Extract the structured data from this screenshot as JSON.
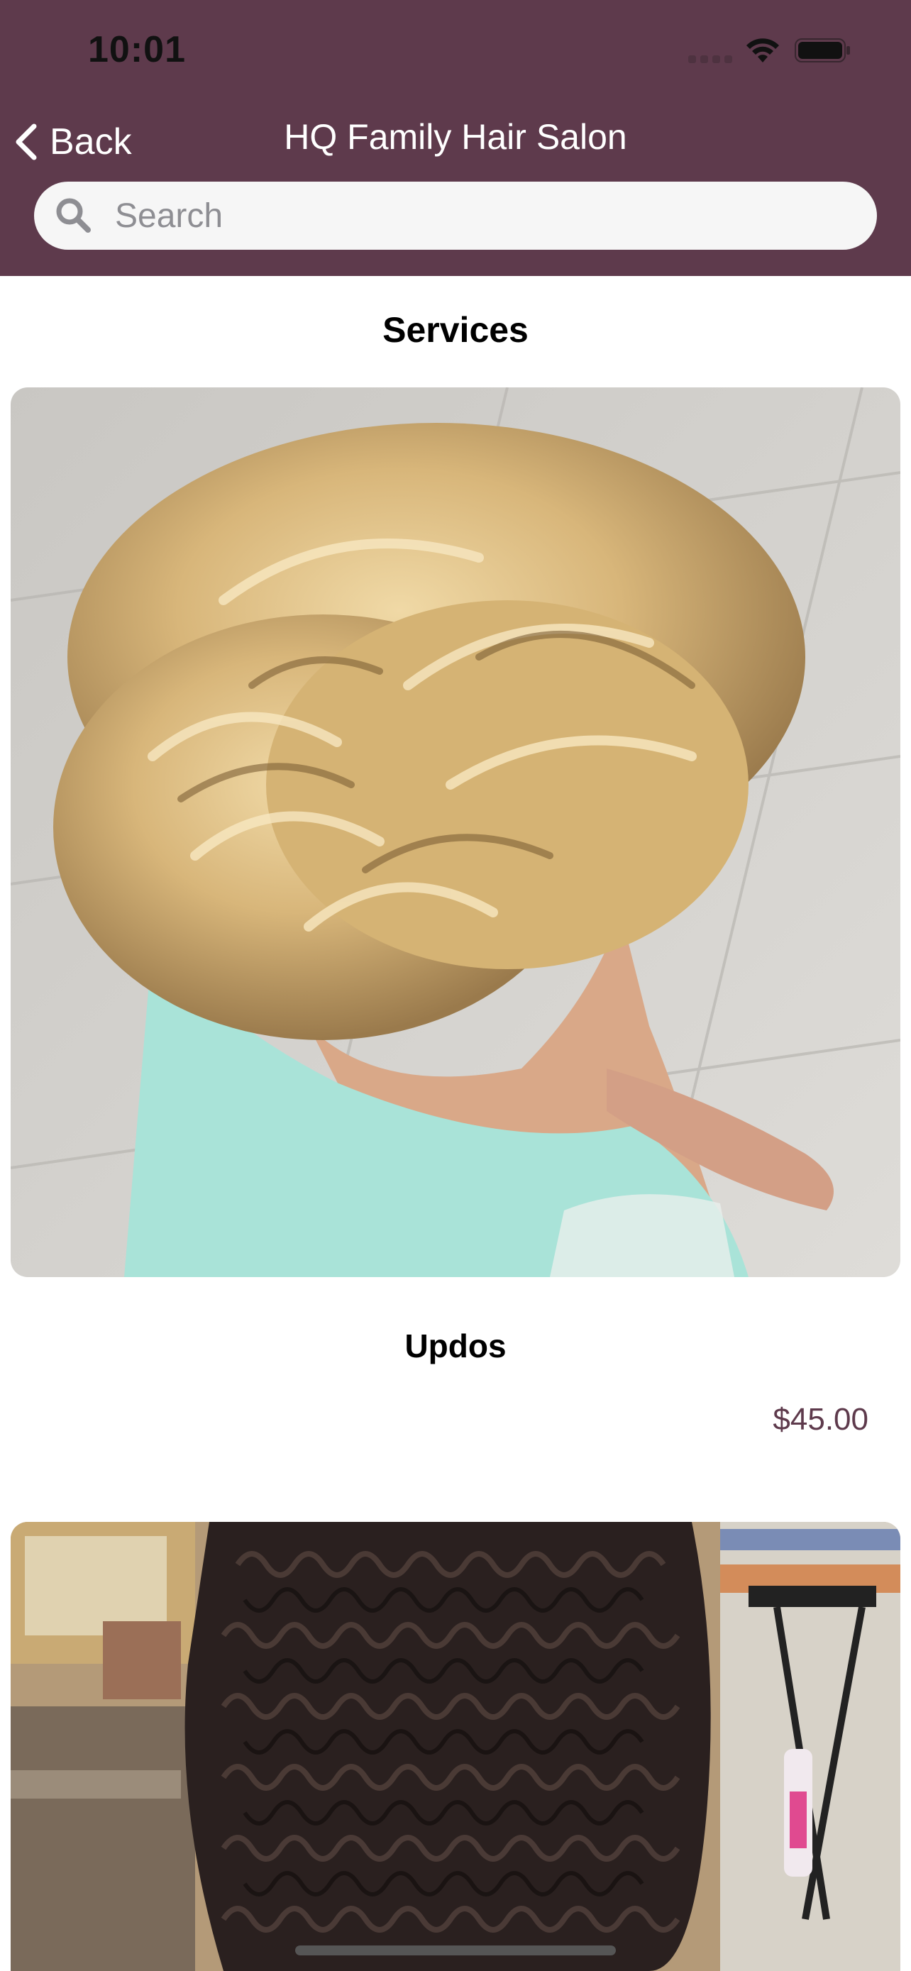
{
  "status_bar": {
    "time": "10:01"
  },
  "nav": {
    "back_label": "Back",
    "title": "HQ Family Hair Salon"
  },
  "search": {
    "placeholder": "Search",
    "value": ""
  },
  "section": {
    "title": "Services"
  },
  "services": [
    {
      "name": "Updos",
      "price": "$45.00"
    },
    {
      "name": "",
      "price": ""
    }
  ],
  "colors": {
    "header": "#5e3a4c",
    "accent": "#5e3a4c"
  }
}
